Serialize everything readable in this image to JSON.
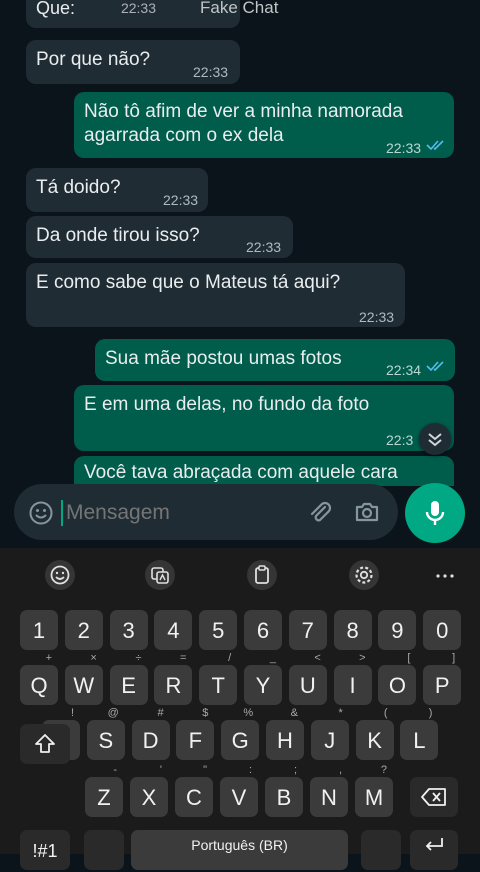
{
  "chat": {
    "title": "Fake Chat",
    "cutoff_text": "Que:",
    "cutoff_time": "22:33",
    "messages": [
      {
        "text": "Por que não?",
        "time": "22:33"
      },
      {
        "line1": "Não tô afim de ver a minha namorada",
        "line2": "agarrada com o ex dela",
        "time": "22:33"
      },
      {
        "text": "Tá doido?",
        "time": "22:33"
      },
      {
        "text": "Da onde tirou isso?",
        "time": "22:33"
      },
      {
        "text": "E como sabe que o Mateus tá aqui?",
        "time": "22:33"
      },
      {
        "text": "Sua mãe postou umas fotos",
        "time": "22:34"
      },
      {
        "text": "E em uma delas, no fundo da foto",
        "time": "22:3"
      },
      {
        "text": "Você tava abraçada com aquele cara"
      }
    ]
  },
  "composer": {
    "placeholder": "Mensagem"
  },
  "keyboard": {
    "numbers": [
      "1",
      "2",
      "3",
      "4",
      "5",
      "6",
      "7",
      "8",
      "9",
      "0"
    ],
    "row1": [
      "Q",
      "W",
      "E",
      "R",
      "T",
      "Y",
      "U",
      "I",
      "O",
      "P"
    ],
    "row1_sup": [
      "+",
      "×",
      "÷",
      "=",
      "/",
      "_",
      "<",
      ">",
      "[",
      "]"
    ],
    "row2": [
      "A",
      "S",
      "D",
      "F",
      "G",
      "H",
      "J",
      "K",
      "L"
    ],
    "row2_sup": [
      "!",
      "@",
      "#",
      "$",
      "%",
      "&",
      "*",
      "(",
      ")"
    ],
    "row3": [
      "Z",
      "X",
      "C",
      "V",
      "B",
      "N",
      "M"
    ],
    "row3_sup": [
      "-",
      "'",
      "\"",
      ":",
      ";",
      ",",
      "?"
    ],
    "symbols_key": "!#1",
    "space_label": "Português (BR)"
  },
  "colors": {
    "outgoing": "#005c4b",
    "incoming": "#202c33",
    "accent": "#00a884",
    "read_ticks": "#53bdeb"
  }
}
